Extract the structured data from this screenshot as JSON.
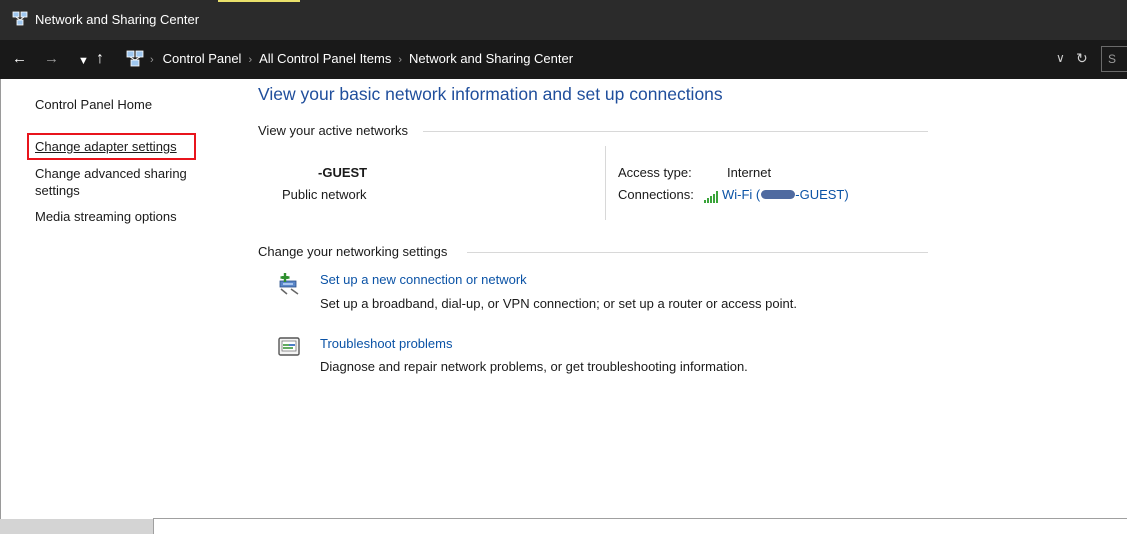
{
  "window": {
    "title": "Network and Sharing Center"
  },
  "address_bar": {
    "breadcrumbs": [
      "Control Panel",
      "All Control Panel Items",
      "Network and Sharing Center"
    ],
    "search_placeholder": "S"
  },
  "sidebar": {
    "items": [
      {
        "label": "Control Panel Home"
      },
      {
        "label": "Change adapter settings",
        "highlighted": true
      },
      {
        "label": "Change advanced sharing settings"
      },
      {
        "label": "Media streaming options"
      }
    ]
  },
  "main": {
    "heading": "View your basic network information and set up connections",
    "active_networks": {
      "section_label": "View your active networks",
      "network_name": "-GUEST",
      "network_type": "Public network",
      "access_type_label": "Access type:",
      "access_type_value": "Internet",
      "connections_label": "Connections:",
      "connection_prefix": "Wi-Fi (",
      "connection_suffix": "-GUEST)"
    },
    "settings": {
      "section_label": "Change your networking settings",
      "tasks": [
        {
          "link": "Set up a new connection or network",
          "description": "Set up a broadband, dial-up, or VPN connection; or set up a router or access point.",
          "icon": "new-connection-icon"
        },
        {
          "link": "Troubleshoot problems",
          "description": "Diagnose and repair network problems, or get troubleshooting information.",
          "icon": "troubleshoot-icon"
        }
      ]
    }
  },
  "colors": {
    "link": "#0b53a6",
    "heading": "#1f4e9c",
    "highlight_border": "#e8141c",
    "titlebar": "#2b2b2b"
  }
}
